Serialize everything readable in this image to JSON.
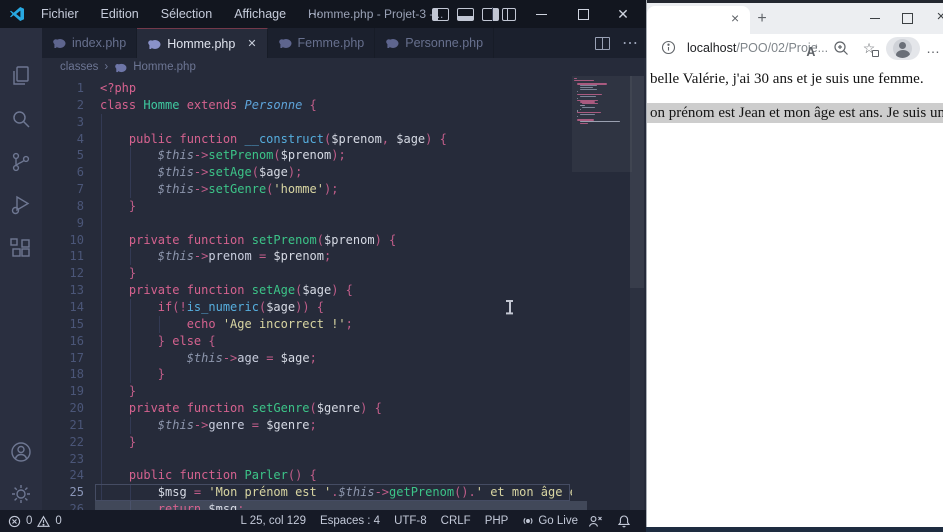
{
  "vscode": {
    "title": "Homme.php - Projet-3 -...",
    "menus": [
      "Fichier",
      "Edition",
      "Sélection",
      "Affichage",
      "⋯"
    ],
    "tabs": [
      {
        "label": "index.php",
        "active": false
      },
      {
        "label": "Homme.php",
        "active": true
      },
      {
        "label": "Femme.php",
        "active": false
      },
      {
        "label": "Personne.php",
        "active": false
      }
    ],
    "breadcrumb": {
      "folder": "classes",
      "file": "Homme.php"
    },
    "editor": {
      "language": "php",
      "active_line": 25,
      "selected_line": 26,
      "lines": [
        [
          [
            "k",
            "<?php"
          ]
        ],
        [
          [
            "k",
            "class "
          ],
          [
            "c",
            "Homme"
          ],
          [
            "k",
            " extends "
          ],
          [
            "ib",
            "Personne"
          ],
          [
            "p",
            " {"
          ]
        ],
        [],
        [
          [
            "w",
            "    "
          ],
          [
            "k",
            "public function "
          ],
          [
            "fb",
            "__construct"
          ],
          [
            "p",
            "("
          ],
          [
            "v",
            "$prenom"
          ],
          [
            "p",
            ", "
          ],
          [
            "v",
            "$age"
          ],
          [
            "p",
            ") {"
          ]
        ],
        [
          [
            "w",
            "        "
          ],
          [
            "t",
            "$this"
          ],
          [
            "p",
            "->"
          ],
          [
            "fg",
            "setPrenom"
          ],
          [
            "p",
            "("
          ],
          [
            "v",
            "$prenom"
          ],
          [
            "p",
            ");"
          ]
        ],
        [
          [
            "w",
            "        "
          ],
          [
            "t",
            "$this"
          ],
          [
            "p",
            "->"
          ],
          [
            "fg",
            "setAge"
          ],
          [
            "p",
            "("
          ],
          [
            "v",
            "$age"
          ],
          [
            "p",
            ");"
          ]
        ],
        [
          [
            "w",
            "        "
          ],
          [
            "t",
            "$this"
          ],
          [
            "p",
            "->"
          ],
          [
            "fg",
            "setGenre"
          ],
          [
            "p",
            "("
          ],
          [
            "s",
            "'homme'"
          ],
          [
            "p",
            ");"
          ]
        ],
        [
          [
            "w",
            "    "
          ],
          [
            "p",
            "}"
          ]
        ],
        [],
        [
          [
            "w",
            "    "
          ],
          [
            "k",
            "private function "
          ],
          [
            "fg",
            "setPrenom"
          ],
          [
            "p",
            "("
          ],
          [
            "v",
            "$prenom"
          ],
          [
            "p",
            ") {"
          ]
        ],
        [
          [
            "w",
            "        "
          ],
          [
            "t",
            "$this"
          ],
          [
            "p",
            "->"
          ],
          [
            "w",
            "prenom"
          ],
          [
            "p",
            " = "
          ],
          [
            "v",
            "$prenom"
          ],
          [
            "p",
            ";"
          ]
        ],
        [
          [
            "w",
            "    "
          ],
          [
            "p",
            "}"
          ]
        ],
        [
          [
            "w",
            "    "
          ],
          [
            "k",
            "private function "
          ],
          [
            "fg",
            "setAge"
          ],
          [
            "p",
            "("
          ],
          [
            "v",
            "$age"
          ],
          [
            "p",
            ") {"
          ]
        ],
        [
          [
            "w",
            "        "
          ],
          [
            "k",
            "if"
          ],
          [
            "p",
            "(!"
          ],
          [
            "fb",
            "is_numeric"
          ],
          [
            "p",
            "("
          ],
          [
            "v",
            "$age"
          ],
          [
            "p",
            ")) {"
          ]
        ],
        [
          [
            "w",
            "            "
          ],
          [
            "k",
            "echo "
          ],
          [
            "s",
            "'Age incorrect !'"
          ],
          [
            "p",
            ";"
          ]
        ],
        [
          [
            "w",
            "        "
          ],
          [
            "p",
            "} "
          ],
          [
            "k",
            "else"
          ],
          [
            "p",
            " {"
          ]
        ],
        [
          [
            "w",
            "            "
          ],
          [
            "t",
            "$this"
          ],
          [
            "p",
            "->"
          ],
          [
            "w",
            "age"
          ],
          [
            "p",
            " = "
          ],
          [
            "v",
            "$age"
          ],
          [
            "p",
            ";"
          ]
        ],
        [
          [
            "w",
            "        "
          ],
          [
            "p",
            "}"
          ]
        ],
        [
          [
            "w",
            "    "
          ],
          [
            "p",
            "}"
          ]
        ],
        [
          [
            "w",
            "    "
          ],
          [
            "k",
            "private function "
          ],
          [
            "fg",
            "setGenre"
          ],
          [
            "p",
            "("
          ],
          [
            "v",
            "$genre"
          ],
          [
            "p",
            ") {"
          ]
        ],
        [
          [
            "w",
            "        "
          ],
          [
            "t",
            "$this"
          ],
          [
            "p",
            "->"
          ],
          [
            "w",
            "genre"
          ],
          [
            "p",
            " = "
          ],
          [
            "v",
            "$genre"
          ],
          [
            "p",
            ";"
          ]
        ],
        [
          [
            "w",
            "    "
          ],
          [
            "p",
            "}"
          ]
        ],
        [],
        [
          [
            "w",
            "    "
          ],
          [
            "k",
            "public function "
          ],
          [
            "fg",
            "Parler"
          ],
          [
            "p",
            "() {"
          ]
        ],
        [
          [
            "w",
            "        "
          ],
          [
            "v",
            "$msg"
          ],
          [
            "p",
            " = "
          ],
          [
            "s",
            "'Mon prénom est '"
          ],
          [
            "p",
            "."
          ],
          [
            "t",
            "$this"
          ],
          [
            "p",
            "->"
          ],
          [
            "fg",
            "getPrenom"
          ],
          [
            "p",
            "()."
          ],
          [
            "s",
            "' et mon âge est"
          ]
        ],
        [
          [
            "w",
            "        "
          ],
          [
            "k",
            "return "
          ],
          [
            "v",
            "$msg"
          ],
          [
            "p",
            ";"
          ]
        ]
      ]
    },
    "status_bar": {
      "errors": "0",
      "warnings": "0",
      "line_col": "L 25, col 129",
      "spaces": "Espaces : 4",
      "encoding": "UTF-8",
      "eol": "CRLF",
      "language": "PHP",
      "go_live": "Go Live"
    }
  },
  "browser": {
    "url_host": "localhost",
    "url_path": "/POO/02/Proje...",
    "content_lines": [
      {
        "text": "belle Valérie, j'ai 30 ans et je suis une femme.",
        "highlighted": false
      },
      {
        "text": "on prénom est Jean et mon âge est ans. Je suis un",
        "highlighted": true
      }
    ]
  },
  "icons": {
    "menu_overflow": "⋯",
    "more_actions": "⋯",
    "breadcrumb_sep": "›",
    "tab_close": "✕",
    "window_close": "✕",
    "browser_tab_close": "×",
    "browser_window_close": "×",
    "new_tab": "+",
    "read_aloud_a": "A",
    "read_aloud_sup": "⁾",
    "favorites_star": "☆",
    "overflow_dots": "…"
  },
  "colors": {
    "accent_blue": "#28a9e2",
    "keyword_pink": "#d5628f",
    "function_green": "#3cc488",
    "class_teal": "#3fc9a0",
    "string_yellow": "#d8d5a2",
    "editor_bg": "#262b3a",
    "selection_gray": "#cdcdcd"
  }
}
